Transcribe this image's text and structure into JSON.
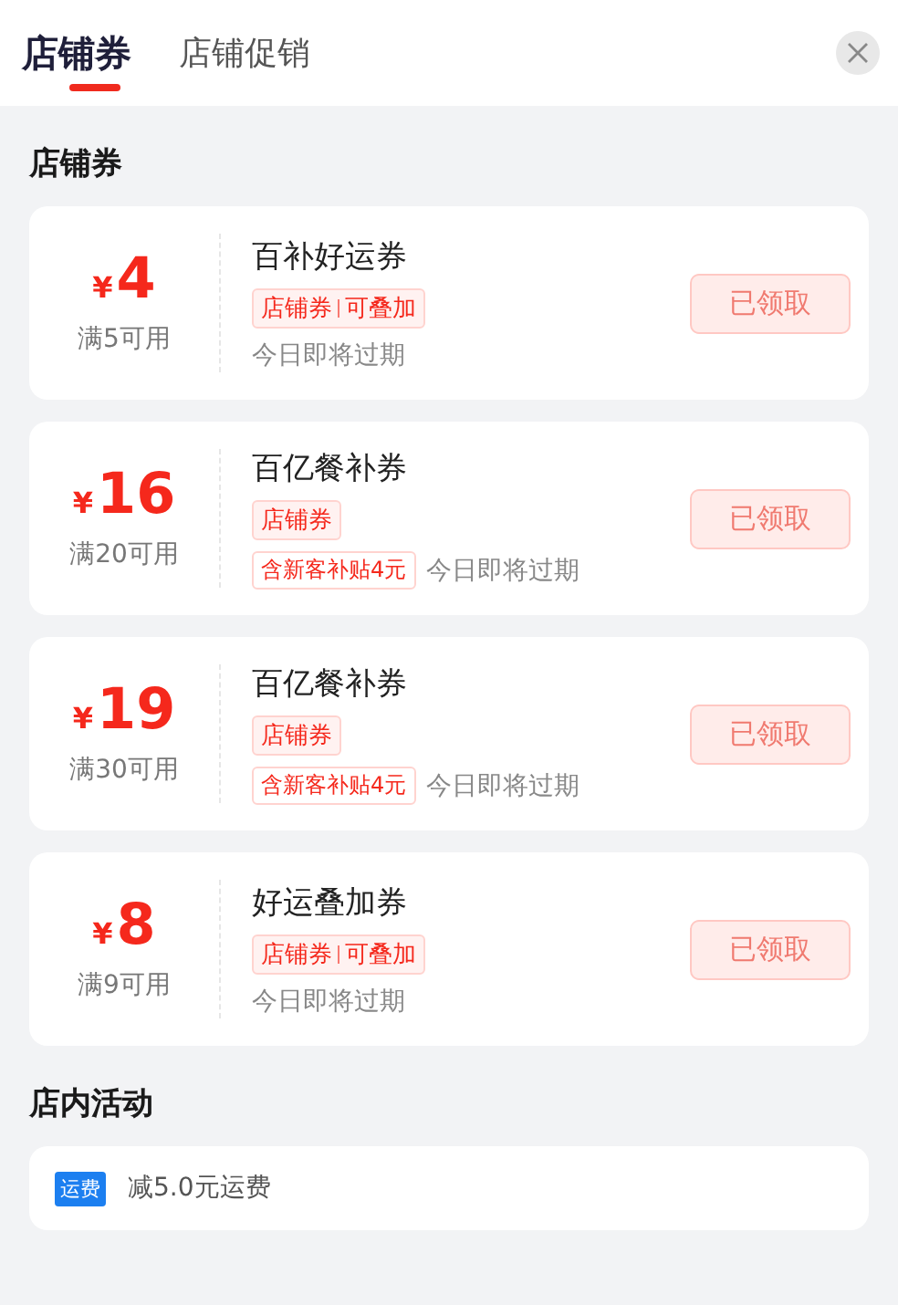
{
  "tabs": [
    {
      "label": "店铺券",
      "selected": true
    },
    {
      "label": "店铺促销",
      "selected": false
    }
  ],
  "sections": [
    {
      "title": "店铺券",
      "kind": "coupons",
      "coupons": [
        {
          "currency": "¥",
          "amount": "4",
          "condition": "满5可用",
          "name": "百补好运券",
          "badge": [
            "店铺券",
            "可叠加"
          ],
          "expiry": "今日即将过期",
          "button": "已领取"
        },
        {
          "currency": "¥",
          "amount": "16",
          "condition": "满20可用",
          "name": "百亿餐补券",
          "badge": [
            "店铺券"
          ],
          "subsidy": "含新客补贴4元",
          "expiry": "今日即将过期",
          "button": "已领取"
        },
        {
          "currency": "¥",
          "amount": "19",
          "condition": "满30可用",
          "name": "百亿餐补券",
          "badge": [
            "店铺券"
          ],
          "subsidy": "含新客补贴4元",
          "expiry": "今日即将过期",
          "button": "已领取"
        },
        {
          "currency": "¥",
          "amount": "8",
          "condition": "满9可用",
          "name": "好运叠加券",
          "badge": [
            "店铺券",
            "可叠加"
          ],
          "expiry": "今日即将过期",
          "button": "已领取"
        }
      ]
    },
    {
      "title": "店内活动",
      "kind": "activities",
      "activities": [
        {
          "tag": "运费",
          "text": "减5.0元运费"
        }
      ]
    }
  ]
}
